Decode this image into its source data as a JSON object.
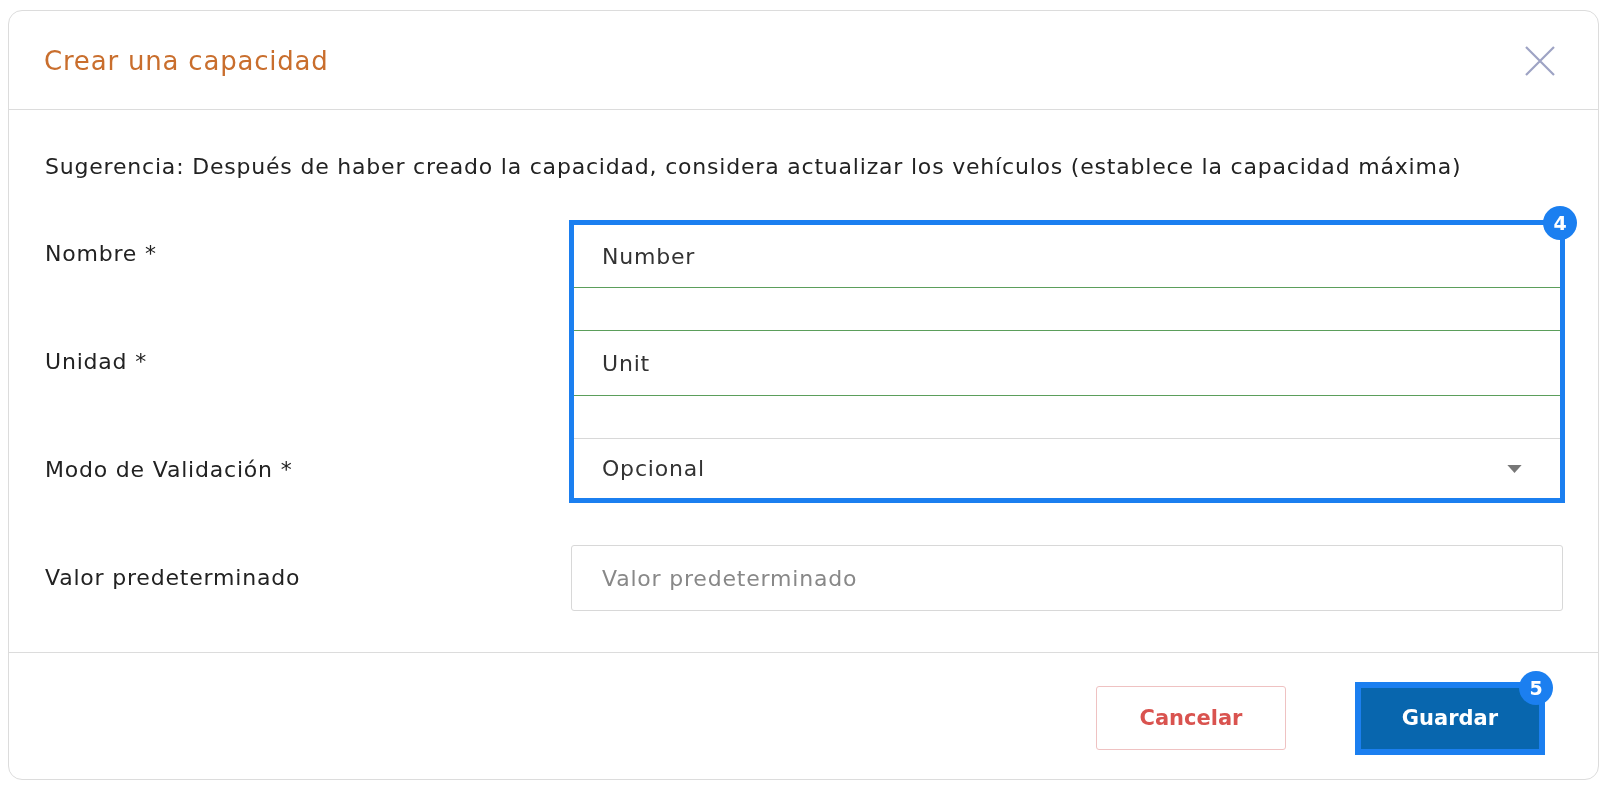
{
  "dialog": {
    "title": "Crear una capacidad",
    "hint": "Sugerencia: Después de haber creado la capacidad, considera actualizar los vehículos (establece la capacidad máxima)"
  },
  "form": {
    "highlight_badge": "4",
    "fields": [
      {
        "label": "Nombre *",
        "kind": "text",
        "value": "Number",
        "validated": true,
        "highlighted": true
      },
      {
        "label": "Unidad *",
        "kind": "text",
        "value": "Unit",
        "validated": true,
        "highlighted": true
      },
      {
        "label": "Modo de Validación *",
        "kind": "select",
        "value": "Opcional",
        "validated": false,
        "highlighted": true
      },
      {
        "label": "Valor predeterminado",
        "kind": "text",
        "placeholder": "Valor predeterminado",
        "validated": false,
        "highlighted": false
      }
    ]
  },
  "buttons": [
    {
      "label": "Cancelar",
      "kind": "secondary",
      "highlighted": false
    },
    {
      "label": "Guardar",
      "kind": "primary",
      "highlighted": true,
      "badge": "5"
    }
  ]
}
